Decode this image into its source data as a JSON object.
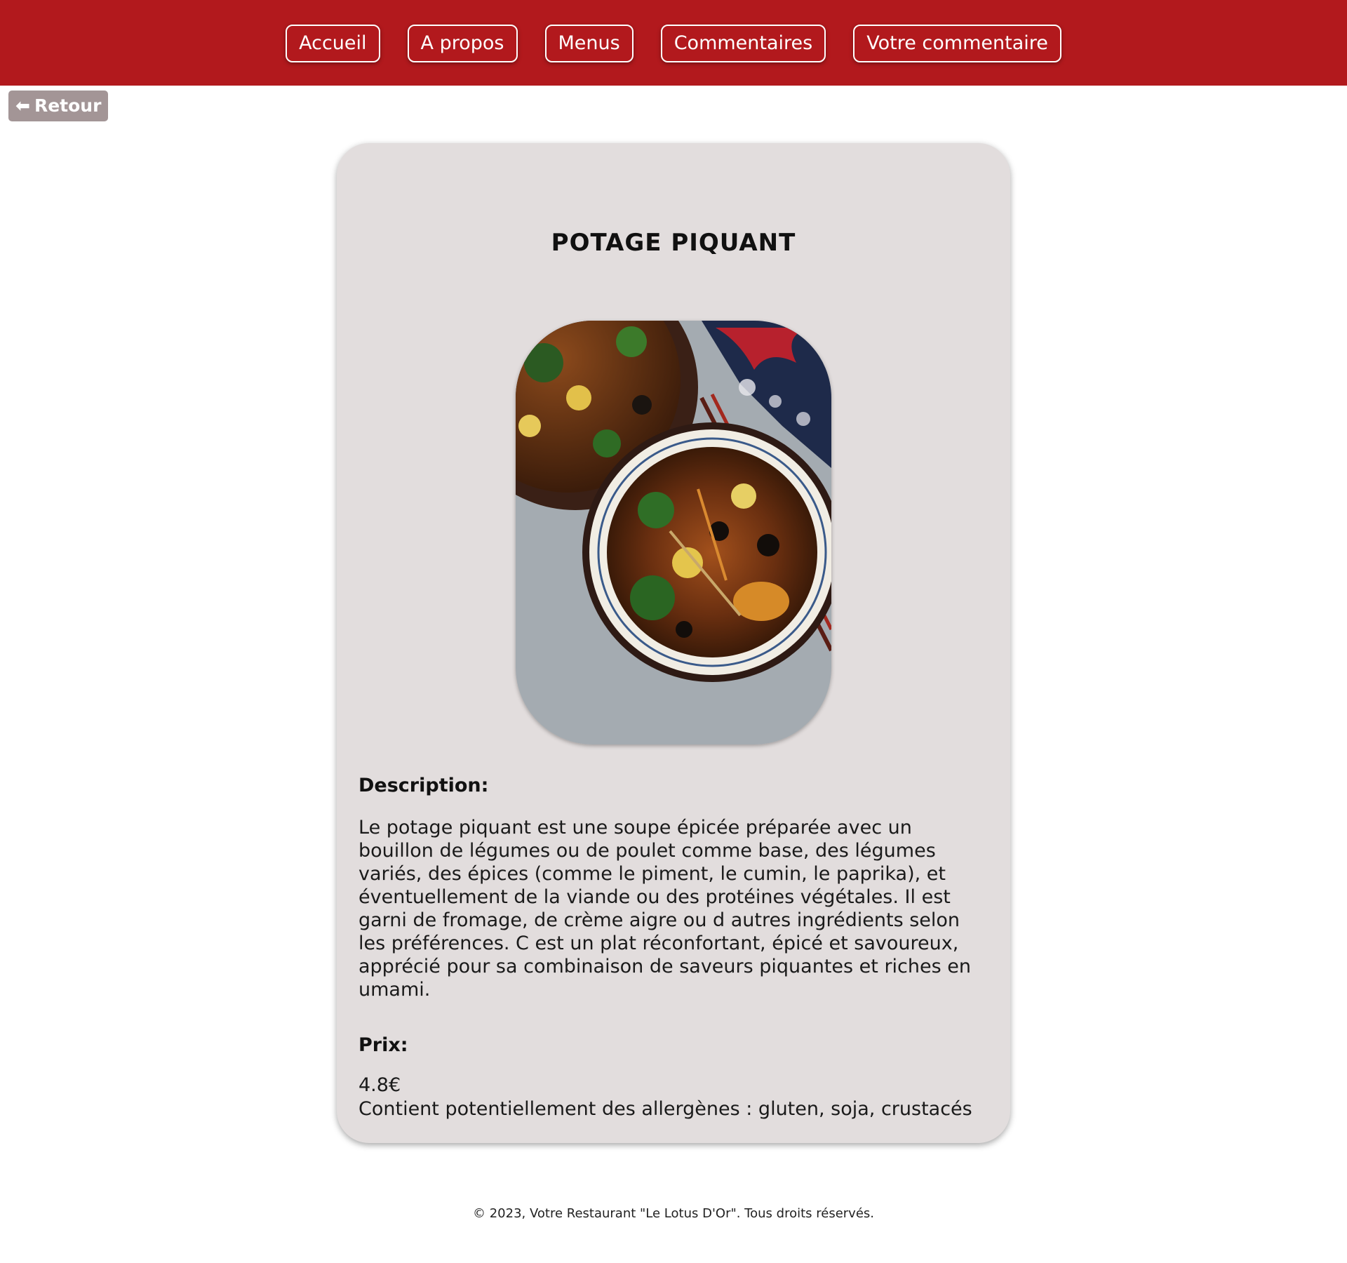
{
  "nav": {
    "items": [
      {
        "label": "Accueil"
      },
      {
        "label": "A propos"
      },
      {
        "label": "Menus"
      },
      {
        "label": "Commentaires"
      },
      {
        "label": "Votre commentaire"
      }
    ],
    "bar_color": "#b2191d"
  },
  "back": {
    "icon": "arrow-left-icon",
    "label": "Retour"
  },
  "dish": {
    "title": "POTAGE PIQUANT",
    "image": {
      "icon": "soup-bowl-photo"
    },
    "description_label": "Description:",
    "description": "Le potage piquant est une soupe épicée préparée avec un bouillon de légumes ou de poulet comme base, des légumes variés, des épices (comme le piment, le cumin, le paprika), et éventuellement de la viande ou des protéines végétales. Il est garni de fromage, de crème aigre ou d autres ingrédients selon les préférences. C est un plat réconfortant, épicé et savoureux, apprécié pour sa combinaison de saveurs piquantes et riches en umami.",
    "price_label": "Prix:",
    "price": "4.8€",
    "allergens": "Contient potentiellement des allergènes : gluten, soja, crustacés"
  },
  "footer": {
    "text": "© 2023, Votre Restaurant \"Le Lotus D'Or\". Tous droits réservés."
  }
}
